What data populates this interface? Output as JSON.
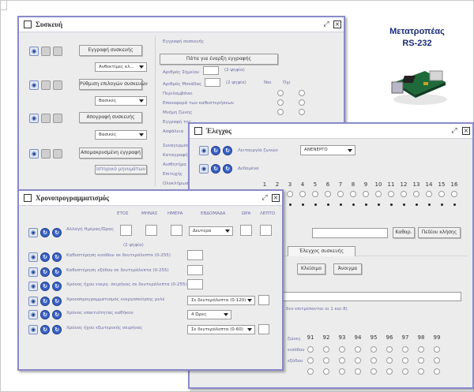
{
  "device_panel": {
    "title": "Μετατροπέας",
    "subtitle": "RS-232"
  },
  "window_device": {
    "title": "Συσκευή",
    "rows": [
      {
        "button": "Εγγραφή συσκευής",
        "dropdown": "Ανθεκτίμες κλ..."
      },
      {
        "button": "Ρύθμιση επιλογών συσκευών",
        "dropdown": "Βασικές"
      },
      {
        "button": "Απογραφή συσκευής",
        "dropdown": "Βασικές"
      },
      {
        "button": "Απομακρυσμένη εγγραφή",
        "dropdown": ""
      }
    ],
    "extra_button": "Ιστορικό μηνυμάτων",
    "right": {
      "header": "Εγγραφή συσκευής",
      "main_button": "Πάτα για έναρξη εγγραφής",
      "rows": [
        {
          "label": "Αριθμός Σημείου",
          "note": "(2 ψηφία)"
        },
        {
          "label": "Αριθμός Μονάδας",
          "note": "(2 ψηφία)"
        }
      ],
      "col_yes": "Ναι",
      "col_no": "Όχι",
      "options": [
        "Περιλαμβάνει",
        "Επαναφορά των καθυστερήσεων",
        "Μνήμη ζώνης",
        "Εγγραφή της",
        "Ασφάλεια",
        "Συναγερμός",
        "Καταγραφή",
        "Αισθητήρα",
        "Επιτυχής",
        "Ολοκλήρωση"
      ]
    }
  },
  "window_control": {
    "title": "Έλεγχος",
    "rows": [
      {
        "label": "Λειτουργία ζωνών",
        "dropdown": "ΑΝΕΝΕΡΓΟ"
      },
      {
        "label": "Δεδομένα",
        "dropdown": ""
      }
    ],
    "numbers_top": [
      "1",
      "2",
      "3",
      "4",
      "5",
      "6",
      "7",
      "8",
      "9",
      "10",
      "11",
      "12",
      "13",
      "14",
      "15",
      "16"
    ],
    "buttons": {
      "clear": "Καθαρ.",
      "clear_all": "Πεδίου κλήσης"
    },
    "tab": "Έλεγχος συσκευής",
    "action_buttons": [
      "Κλείσιμο",
      "Άνοιγμα"
    ],
    "note": "δεν επιτρέπονται οι 1 και 8)",
    "numbers_bottom": [
      "91",
      "92",
      "93",
      "94",
      "95",
      "96",
      "97",
      "98",
      "99"
    ],
    "bottom_labels": [
      "ζώνες",
      "εισόδου",
      "εξόδου"
    ]
  },
  "window_schedule": {
    "title": "Χρονοπρογραμματισμός",
    "columns": [
      "ΕΤΟΣ",
      "ΜΗΝΑΣ",
      "ΗΜΕΡΑ",
      "ΕΒΔΟΜΑΔΑ",
      "ΩΡΑ",
      "ΛΕΠΤΟ"
    ],
    "rows": [
      {
        "label": "Αλλαγή Ημέρας/Ώρας",
        "sub": "(2 ψηφία)",
        "widget": "dropdown",
        "value": "Δευτέρα"
      },
      {
        "label": "Καθυστέρηση εισόδου σε δευτερόλεπτα (0-255)",
        "widget": "textbox",
        "value": ""
      },
      {
        "label": "Καθυστέρηση εξόδου σε δευτερόλεπτα (0-255)",
        "widget": "textbox",
        "value": ""
      },
      {
        "label": "Χρόνος ήχου ενεργ. σειρήνας σε δευτερόλεπτα (0-255)",
        "widget": "textbox",
        "value": ""
      },
      {
        "label": "Χρονοπρογραμματισμός ενεργοποίησης ρελέ",
        "widget": "dropdown",
        "value": "Σε δευτερόλεπτα (0-120)"
      },
      {
        "label": "Χρόνος υπαιτιότητας καθήκον",
        "widget": "dropdown",
        "value": "4 Ώρες"
      },
      {
        "label": "Χρόνος ήχου εξωτερικής σειρήνας",
        "widget": "dropdown",
        "value": "Σε δευτερόλεπτα (0-60)"
      }
    ]
  }
}
